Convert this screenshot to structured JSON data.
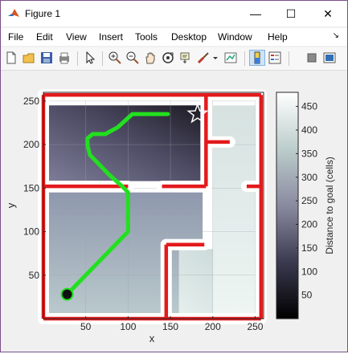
{
  "window": {
    "title": "Figure 1",
    "controls": {
      "minimize": "—",
      "maximize": "☐",
      "close": "✕"
    }
  },
  "menu": {
    "items": [
      "File",
      "Edit",
      "View",
      "Insert",
      "Tools",
      "Desktop",
      "Window",
      "Help"
    ],
    "overflow_arrow": "↘"
  },
  "toolbar": {
    "icons": [
      "new-figure-icon",
      "open-file-icon",
      "save-icon",
      "print-icon",
      "pointer-icon",
      "zoom-in-icon",
      "zoom-out-icon",
      "pan-icon",
      "rotate-3d-icon",
      "data-cursor-icon",
      "brush-icon",
      "link-plot-icon",
      "colorbar-icon",
      "legend-icon",
      "hide-plot-tools-icon",
      "show-plot-tools-icon"
    ]
  },
  "chart_data": {
    "type": "heatmap",
    "title": "",
    "xlabel": "x",
    "ylabel": "y",
    "xlim": [
      0,
      260
    ],
    "ylim": [
      0,
      260
    ],
    "xticks": [
      "50",
      "100",
      "150",
      "200",
      "250"
    ],
    "yticks": [
      "50",
      "100",
      "150",
      "200",
      "250"
    ],
    "colorbar": {
      "label": "Distance to goal (cells)",
      "range": [
        0,
        480
      ],
      "ticks": [
        "50",
        "100",
        "150",
        "200",
        "250",
        "300",
        "350",
        "400",
        "450"
      ]
    },
    "path": {
      "color": "#22e01f",
      "x": [
        28,
        100,
        100,
        93,
        78,
        55,
        52,
        52,
        58,
        73,
        88,
        105,
        147
      ],
      "y": [
        28,
        100,
        145,
        152,
        165,
        188,
        199,
        207,
        212,
        212,
        220,
        235,
        235
      ]
    },
    "start": {
      "x": 28,
      "y": 28
    },
    "goal": {
      "x": 182,
      "y": 235
    }
  }
}
